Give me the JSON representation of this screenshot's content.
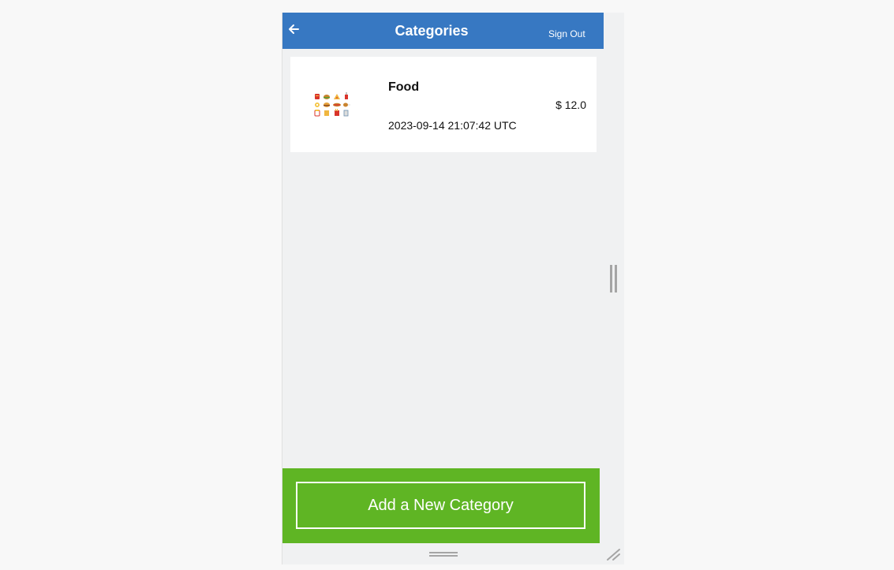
{
  "header": {
    "title": "Categories",
    "sign_out_label": "Sign Out",
    "back_icon": "arrow-left-icon",
    "color": "#3778c2"
  },
  "categories": [
    {
      "name": "Food",
      "amount": "$ 12.0",
      "created_at": "2023-09-14 21:07:42 UTC",
      "icon": "food-icon"
    }
  ],
  "footer": {
    "add_button_label": "Add a New Category",
    "color": "#5fb524"
  },
  "colors": {
    "background": "#f0f1f2",
    "card": "#ffffff"
  }
}
